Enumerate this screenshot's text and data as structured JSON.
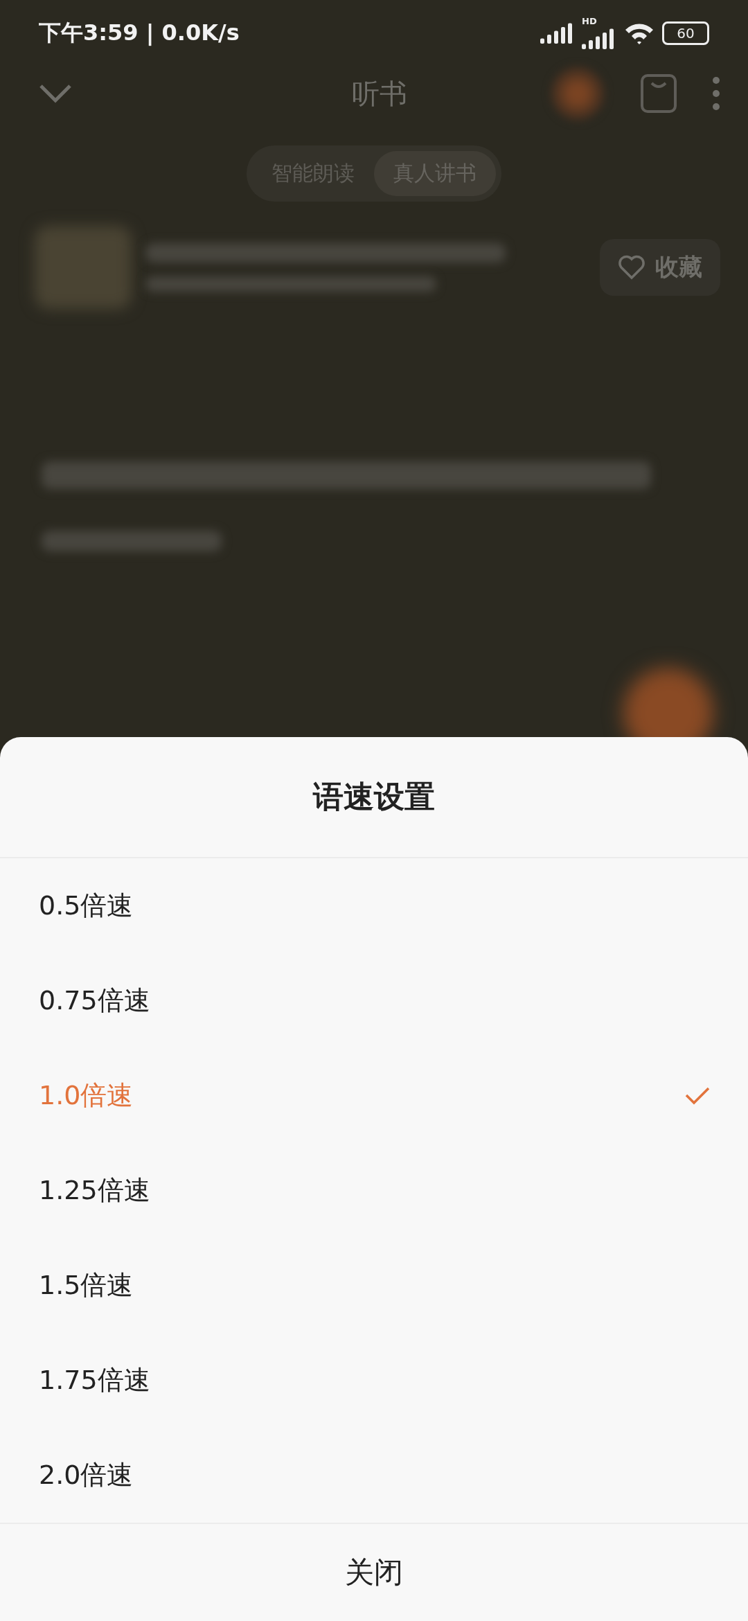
{
  "status_bar": {
    "time": "下午3:59 | 0.0K/s",
    "network": "HD",
    "battery": "60"
  },
  "header": {
    "title": "听书"
  },
  "tabs": [
    {
      "label": "智能朗读",
      "selected": false
    },
    {
      "label": "真人讲书",
      "selected": true
    }
  ],
  "favorite_button": {
    "label": "收藏"
  },
  "sheet": {
    "title": "语速设置",
    "options": [
      {
        "label": "0.5倍速",
        "selected": false
      },
      {
        "label": "0.75倍速",
        "selected": false
      },
      {
        "label": "1.0倍速",
        "selected": true
      },
      {
        "label": "1.25倍速",
        "selected": false
      },
      {
        "label": "1.5倍速",
        "selected": false
      },
      {
        "label": "1.75倍速",
        "selected": false
      },
      {
        "label": "2.0倍速",
        "selected": false
      }
    ],
    "close": "关闭"
  }
}
